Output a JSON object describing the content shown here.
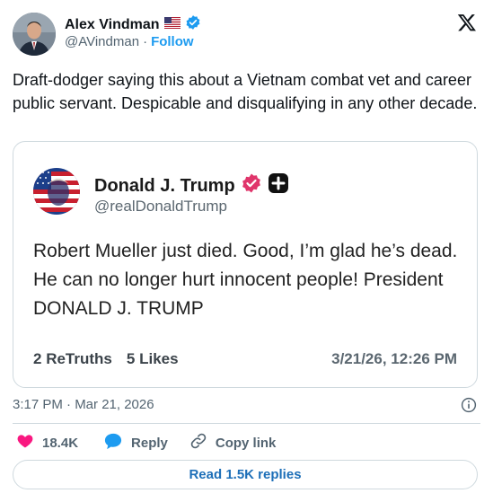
{
  "author": {
    "name": "Alex Vindman",
    "flag": "🇺🇸",
    "handle": "@AVindman",
    "separator": "·",
    "follow_label": "Follow"
  },
  "tweet": {
    "text": "Draft-dodger saying this about a Vietnam combat vet and career public servant. Despicable and disqualifying in any other decade.",
    "timestamp": "3:17 PM · Mar 21, 2026"
  },
  "quote": {
    "name": "Donald J. Trump",
    "handle": "@realDonaldTrump",
    "text": "Robert Mueller just died. Good, I’m glad he’s dead. He can no longer hurt innocent people! President DONALD J. TRUMP",
    "retruths_count": "2",
    "retruths_label": "ReTruths",
    "likes_count": "5",
    "likes_label": "Likes",
    "date": "3/21/26, 12:26 PM"
  },
  "actions": {
    "like_count": "18.4K",
    "reply_label": "Reply",
    "copy_label": "Copy link",
    "replies_button": "Read 1.5K replies"
  },
  "colors": {
    "accent": "#1d9bf0",
    "like": "#f91880",
    "verified_pink": "#e0356b",
    "text_secondary": "#536471"
  }
}
